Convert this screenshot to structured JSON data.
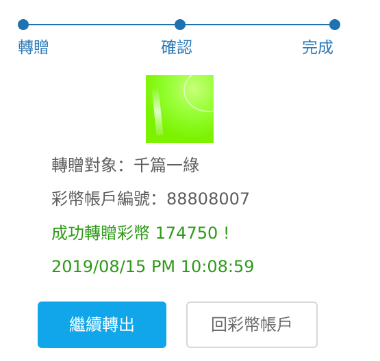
{
  "stepper": {
    "steps": [
      {
        "label": "轉贈"
      },
      {
        "label": "確認"
      },
      {
        "label": "完成"
      }
    ],
    "color": "#1f72b0"
  },
  "avatar": {
    "icon": "profile-image"
  },
  "details": {
    "target_label": "轉贈對象：",
    "target_value": "千篇一綠",
    "account_label": "彩幣帳戶編號：",
    "account_value": "88808007",
    "success_prefix": "成功轉贈彩幣",
    "success_amount": "174750",
    "success_suffix": "!",
    "datetime": "2019/08/15 PM 10:08:59"
  },
  "buttons": {
    "continue_label": "繼續轉出",
    "back_label": "回彩幣帳戶"
  },
  "colors": {
    "accent": "#11a6ea",
    "success": "#2d9a17",
    "text": "#5e5e5e"
  }
}
